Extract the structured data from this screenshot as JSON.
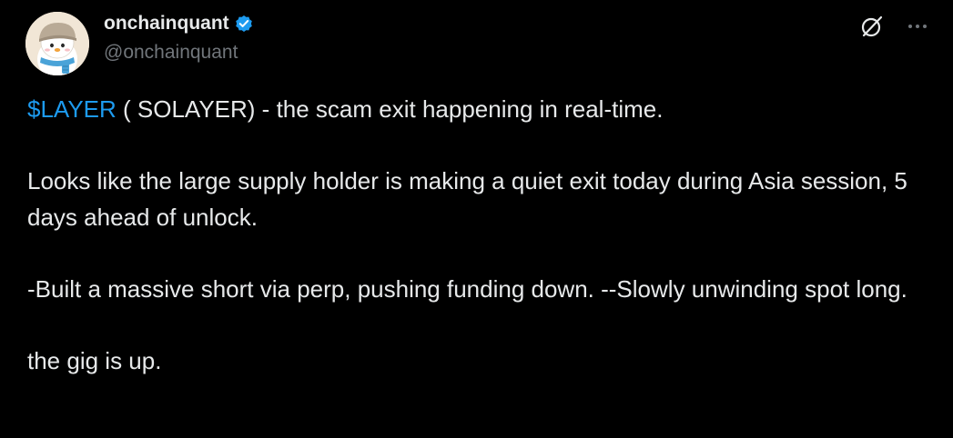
{
  "author": {
    "display_name": "onchainquant",
    "handle": "@onchainquant",
    "verified": true
  },
  "header_actions": {
    "grok_icon": "grok-icon",
    "more_icon": "more-icon"
  },
  "tweet": {
    "cashtag": "$LAYER",
    "line1_rest": " ( SOLAYER) - the scam exit happening in real-time.",
    "para2": "Looks like the large supply holder is making a quiet exit today during Asia session, 5 days ahead of unlock.",
    "para3": "-Built a massive short via perp, pushing funding down. --Slowly unwinding spot long.",
    "para4": "the gig is up."
  },
  "colors": {
    "background": "#000000",
    "text": "#e7e9ea",
    "secondary_text": "#71767b",
    "accent": "#1d9bf0"
  }
}
